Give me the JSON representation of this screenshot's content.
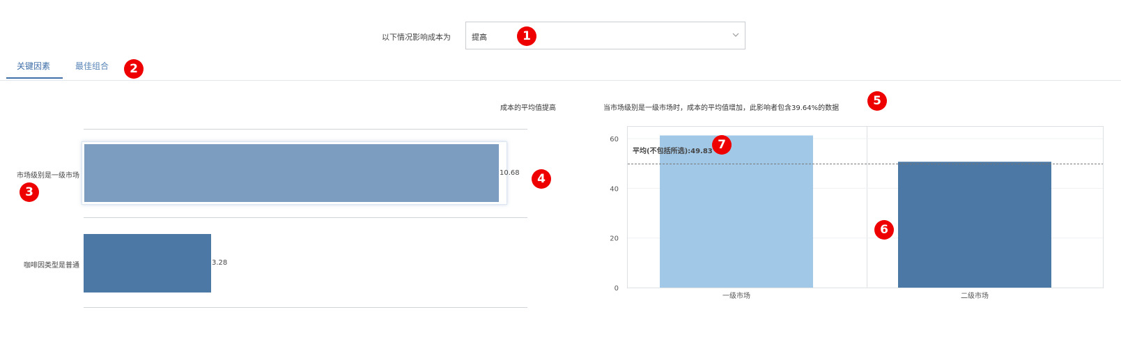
{
  "filter": {
    "label": "以下情况影响成本为",
    "value": "提高"
  },
  "tabs": [
    {
      "label": "关键因素",
      "active": true
    },
    {
      "label": "最佳组合",
      "active": false
    }
  ],
  "left_chart_title": "成本的平均值提高",
  "right_chart_title": "当市场级别是一级市场时，成本的平均值增加，此影响者包含39.64%的数据",
  "avg_line_label": "平均(不包括所选):49.83",
  "markers": [
    "1",
    "2",
    "3",
    "4",
    "5",
    "6",
    "7"
  ],
  "colors": {
    "accent": "#3f6fa8",
    "bar_selected": "#7c9cc0",
    "bar_default": "#4c78a6",
    "bar_light": "#a2c8e7",
    "marker": "#ee0000"
  },
  "chart_data": [
    {
      "type": "bar",
      "orientation": "horizontal",
      "title": "成本的平均值提高",
      "categories": [
        "市场级别是一级市场",
        "咖啡因类型是普通"
      ],
      "values": [
        10.68,
        3.28
      ],
      "value_labels": [
        "10.68",
        "3.28"
      ],
      "selected_index": 0,
      "xlim": [
        0,
        10.9
      ]
    },
    {
      "type": "bar",
      "title": "当市场级别是一级市场时，成本的平均值增加，此影响者包含39.64%的数据",
      "categories": [
        "一级市场",
        "二级市场"
      ],
      "values": [
        61.3,
        50.7
      ],
      "ylim": [
        0,
        62
      ],
      "yticks": [
        "0",
        "20",
        "40",
        "60"
      ],
      "reference_line": {
        "label": "平均(不包括所选):49.83",
        "value": 49.83
      },
      "grid": true
    }
  ]
}
